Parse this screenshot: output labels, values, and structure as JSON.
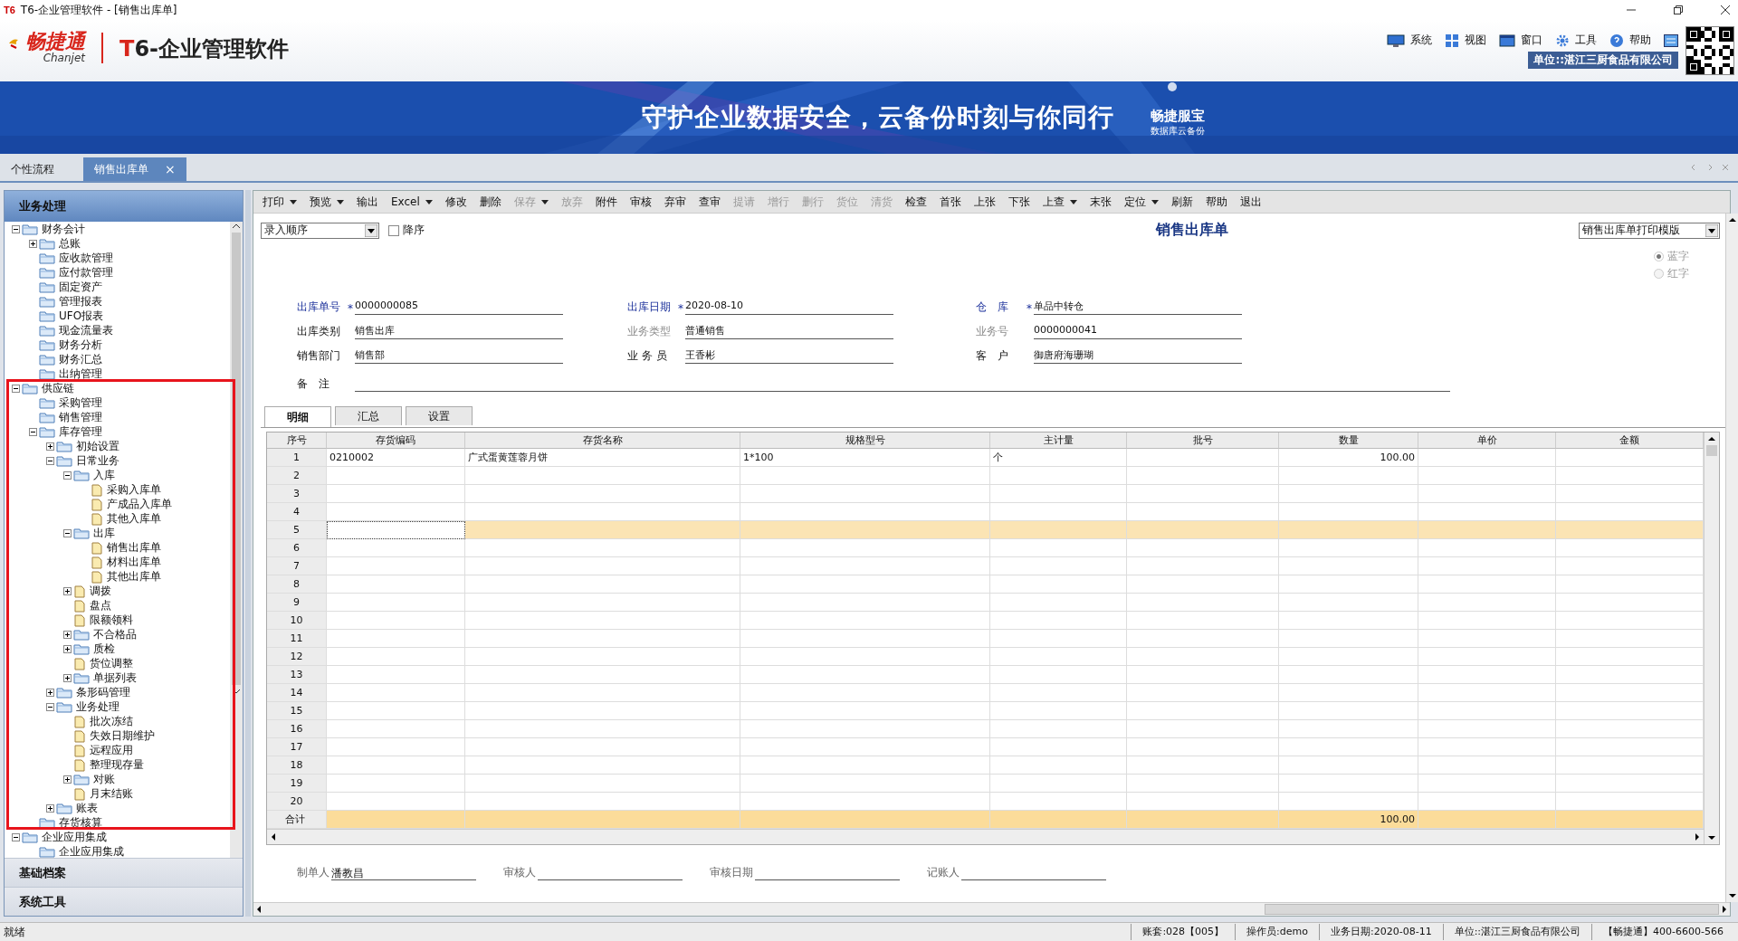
{
  "window": {
    "title": "T6-企业管理软件 - [销售出库单]",
    "icon": "T6"
  },
  "header": {
    "brand": "畅捷通",
    "brand_sub": "Chanjet",
    "product": "T6-企业管理软件",
    "menu": [
      {
        "label": "系统"
      },
      {
        "label": "视图"
      },
      {
        "label": "窗口"
      },
      {
        "label": "工具"
      },
      {
        "label": "帮助"
      }
    ],
    "unit": "单位::湛江三厨食品有限公司"
  },
  "banner": {
    "slogan": "守护企业数据安全，云备份时刻与你同行",
    "badge": "畅捷服宝",
    "badge_sub": "数据库云备份"
  },
  "tabs": [
    {
      "label": "个性流程",
      "selected": false
    },
    {
      "label": "销售出库单",
      "selected": true,
      "close": "×"
    }
  ],
  "sidebar": {
    "title": "业务处理",
    "tree": [
      {
        "label": "财务会计",
        "kind": "folder",
        "expanded": true,
        "children": [
          {
            "label": "总账",
            "kind": "folder",
            "expanded": false
          },
          {
            "label": "应收款管理",
            "kind": "folder"
          },
          {
            "label": "应付款管理",
            "kind": "folder"
          },
          {
            "label": "固定资产",
            "kind": "folder"
          },
          {
            "label": "管理报表",
            "kind": "folder"
          },
          {
            "label": "UFO报表",
            "kind": "folder"
          },
          {
            "label": "现金流量表",
            "kind": "folder"
          },
          {
            "label": "财务分析",
            "kind": "folder"
          },
          {
            "label": "财务汇总",
            "kind": "folder"
          },
          {
            "label": "出纳管理",
            "kind": "folder"
          }
        ]
      },
      {
        "label": "供应链",
        "kind": "folder",
        "expanded": true,
        "children": [
          {
            "label": "采购管理",
            "kind": "folder"
          },
          {
            "label": "销售管理",
            "kind": "folder"
          },
          {
            "label": "库存管理",
            "kind": "folder",
            "expanded": true,
            "children": [
              {
                "label": "初始设置",
                "kind": "folder",
                "expanded": false
              },
              {
                "label": "日常业务",
                "kind": "folder",
                "expanded": true,
                "children": [
                  {
                    "label": "入库",
                    "kind": "folder",
                    "expanded": true,
                    "children": [
                      {
                        "label": "采购入库单",
                        "kind": "doc"
                      },
                      {
                        "label": "产成品入库单",
                        "kind": "doc"
                      },
                      {
                        "label": "其他入库单",
                        "kind": "doc"
                      }
                    ]
                  },
                  {
                    "label": "出库",
                    "kind": "folder",
                    "expanded": true,
                    "children": [
                      {
                        "label": "销售出库单",
                        "kind": "doc"
                      },
                      {
                        "label": "材料出库单",
                        "kind": "doc"
                      },
                      {
                        "label": "其他出库单",
                        "kind": "doc"
                      }
                    ]
                  },
                  {
                    "label": "调拨",
                    "kind": "doc",
                    "expanded": false
                  },
                  {
                    "label": "盘点",
                    "kind": "doc"
                  },
                  {
                    "label": "限额领料",
                    "kind": "doc"
                  },
                  {
                    "label": "不合格品",
                    "kind": "folder",
                    "expanded": false
                  },
                  {
                    "label": "质检",
                    "kind": "folder",
                    "expanded": false
                  },
                  {
                    "label": "货位调整",
                    "kind": "doc"
                  },
                  {
                    "label": "单据列表",
                    "kind": "folder",
                    "expanded": false
                  }
                ]
              },
              {
                "label": "条形码管理",
                "kind": "folder",
                "expanded": false
              },
              {
                "label": "业务处理",
                "kind": "folder",
                "expanded": true,
                "children": [
                  {
                    "label": "批次冻结",
                    "kind": "doc"
                  },
                  {
                    "label": "失效日期维护",
                    "kind": "doc"
                  },
                  {
                    "label": "远程应用",
                    "kind": "doc"
                  },
                  {
                    "label": "整理现存量",
                    "kind": "doc"
                  },
                  {
                    "label": "对账",
                    "kind": "folder",
                    "expanded": false
                  },
                  {
                    "label": "月末结账",
                    "kind": "doc"
                  }
                ]
              },
              {
                "label": "账表",
                "kind": "folder",
                "expanded": false
              }
            ]
          },
          {
            "label": "存货核算",
            "kind": "folder"
          }
        ]
      },
      {
        "label": "企业应用集成",
        "kind": "folder",
        "expanded": true,
        "children": [
          {
            "label": "企业应用集成",
            "kind": "folder"
          }
        ]
      }
    ],
    "sections": [
      "基础档案",
      "系统工具"
    ]
  },
  "toolbar": [
    {
      "label": "打印",
      "dropdown": true,
      "disabled": false
    },
    {
      "label": "预览",
      "dropdown": true,
      "disabled": false
    },
    {
      "label": "输出",
      "dropdown": false,
      "disabled": false
    },
    {
      "label": "Excel",
      "dropdown": true,
      "disabled": false
    },
    {
      "label": "修改",
      "dropdown": false,
      "disabled": false
    },
    {
      "label": "删除",
      "dropdown": false,
      "disabled": false
    },
    {
      "label": "保存",
      "dropdown": true,
      "disabled": true
    },
    {
      "label": "放弃",
      "dropdown": false,
      "disabled": true
    },
    {
      "label": "附件",
      "dropdown": false,
      "disabled": false
    },
    {
      "label": "审核",
      "dropdown": false,
      "disabled": false
    },
    {
      "label": "弃审",
      "dropdown": false,
      "disabled": false
    },
    {
      "label": "查审",
      "dropdown": false,
      "disabled": false
    },
    {
      "label": "提请",
      "dropdown": false,
      "disabled": true
    },
    {
      "label": "增行",
      "dropdown": false,
      "disabled": true
    },
    {
      "label": "删行",
      "dropdown": false,
      "disabled": true
    },
    {
      "label": "货位",
      "dropdown": false,
      "disabled": true
    },
    {
      "label": "清货",
      "dropdown": false,
      "disabled": true
    },
    {
      "label": "检查",
      "dropdown": false,
      "disabled": false
    },
    {
      "label": "首张",
      "dropdown": false,
      "disabled": false
    },
    {
      "label": "上张",
      "dropdown": false,
      "disabled": false
    },
    {
      "label": "下张",
      "dropdown": false,
      "disabled": false
    },
    {
      "label": "上查",
      "dropdown": true,
      "disabled": false
    },
    {
      "label": "末张",
      "dropdown": false,
      "disabled": false
    },
    {
      "label": "定位",
      "dropdown": true,
      "disabled": false
    },
    {
      "label": "刷新",
      "dropdown": false,
      "disabled": false
    },
    {
      "label": "帮助",
      "dropdown": false,
      "disabled": false
    },
    {
      "label": "退出",
      "dropdown": false,
      "disabled": false
    }
  ],
  "form": {
    "title": "销售出库单",
    "sort": {
      "value": "录入顺序"
    },
    "descending": {
      "label": "降序",
      "checked": false
    },
    "template": {
      "value": "销售出库单打印模版"
    },
    "color_mode": [
      {
        "label": "蓝字",
        "selected": true,
        "disabled": true
      },
      {
        "label": "红字",
        "selected": false,
        "disabled": true
      }
    ],
    "fields": [
      {
        "label": "出库单号",
        "required_mark": "*",
        "value": "0000000085",
        "key_field": true,
        "muted": false
      },
      {
        "label": "出库日期",
        "required_mark": "*",
        "value": "2020-08-10",
        "key_field": true,
        "muted": false
      },
      {
        "label": "仓　库",
        "required_mark": "*",
        "value": "单品中转仓",
        "key_field": true,
        "muted": false
      },
      {
        "label": "出库类别",
        "value": "销售出库",
        "key_field": false,
        "muted": false
      },
      {
        "label": "业务类型",
        "value": "普通销售",
        "key_field": false,
        "muted": true
      },
      {
        "label": "业务号",
        "value": "0000000041",
        "key_field": false,
        "muted": true
      },
      {
        "label": "销售部门",
        "value": "销售部",
        "key_field": false,
        "muted": false
      },
      {
        "label": "业 务 员",
        "value": "王香彬",
        "key_field": false,
        "muted": false
      },
      {
        "label": "客　户",
        "value": "御唐府海珊瑚",
        "key_field": false,
        "muted": false
      }
    ],
    "remark": {
      "label": "备　注"
    },
    "tabs": [
      {
        "label": "明细",
        "selected": true
      },
      {
        "label": "汇总",
        "selected": false
      },
      {
        "label": "设置",
        "selected": false
      }
    ],
    "columns": [
      "序号",
      "存货编码",
      "存货名称",
      "规格型号",
      "主计量",
      "批号",
      "数量",
      "单价",
      "金额"
    ],
    "rows": [
      {
        "no": "1",
        "code": "0210002",
        "name": "广式蛋黄莲蓉月饼",
        "spec": "1*100",
        "unit": "个",
        "qty": "100.00",
        "selected": false
      },
      {
        "no": "2",
        "selected": false
      },
      {
        "no": "3",
        "selected": false
      },
      {
        "no": "4",
        "selected": false
      },
      {
        "no": "5",
        "selected": true
      },
      {
        "no": "6",
        "selected": false
      },
      {
        "no": "7",
        "selected": false
      },
      {
        "no": "8",
        "selected": false
      },
      {
        "no": "9",
        "selected": false
      },
      {
        "no": "10",
        "selected": false
      },
      {
        "no": "11",
        "selected": false
      },
      {
        "no": "12",
        "selected": false
      },
      {
        "no": "13",
        "selected": false
      },
      {
        "no": "14",
        "selected": false
      },
      {
        "no": "15",
        "selected": false
      },
      {
        "no": "16",
        "selected": false
      },
      {
        "no": "17",
        "selected": false
      },
      {
        "no": "18",
        "selected": false
      },
      {
        "no": "19",
        "selected": false
      },
      {
        "no": "20",
        "selected": false
      }
    ],
    "total": {
      "label": "合计",
      "qty": "100.00"
    },
    "signatures": [
      {
        "label": "制单人",
        "value": "潘教昌"
      },
      {
        "label": "审核人"
      },
      {
        "label": "审核日期"
      },
      {
        "label": "记账人"
      }
    ]
  },
  "status_bar": {
    "message": "就绪",
    "segments": [
      "账套:028【005】",
      "操作员:demo",
      "业务日期:2020-08-11",
      "单位::湛江三厨食品有限公司",
      "【畅捷通】400-6600-566"
    ]
  }
}
